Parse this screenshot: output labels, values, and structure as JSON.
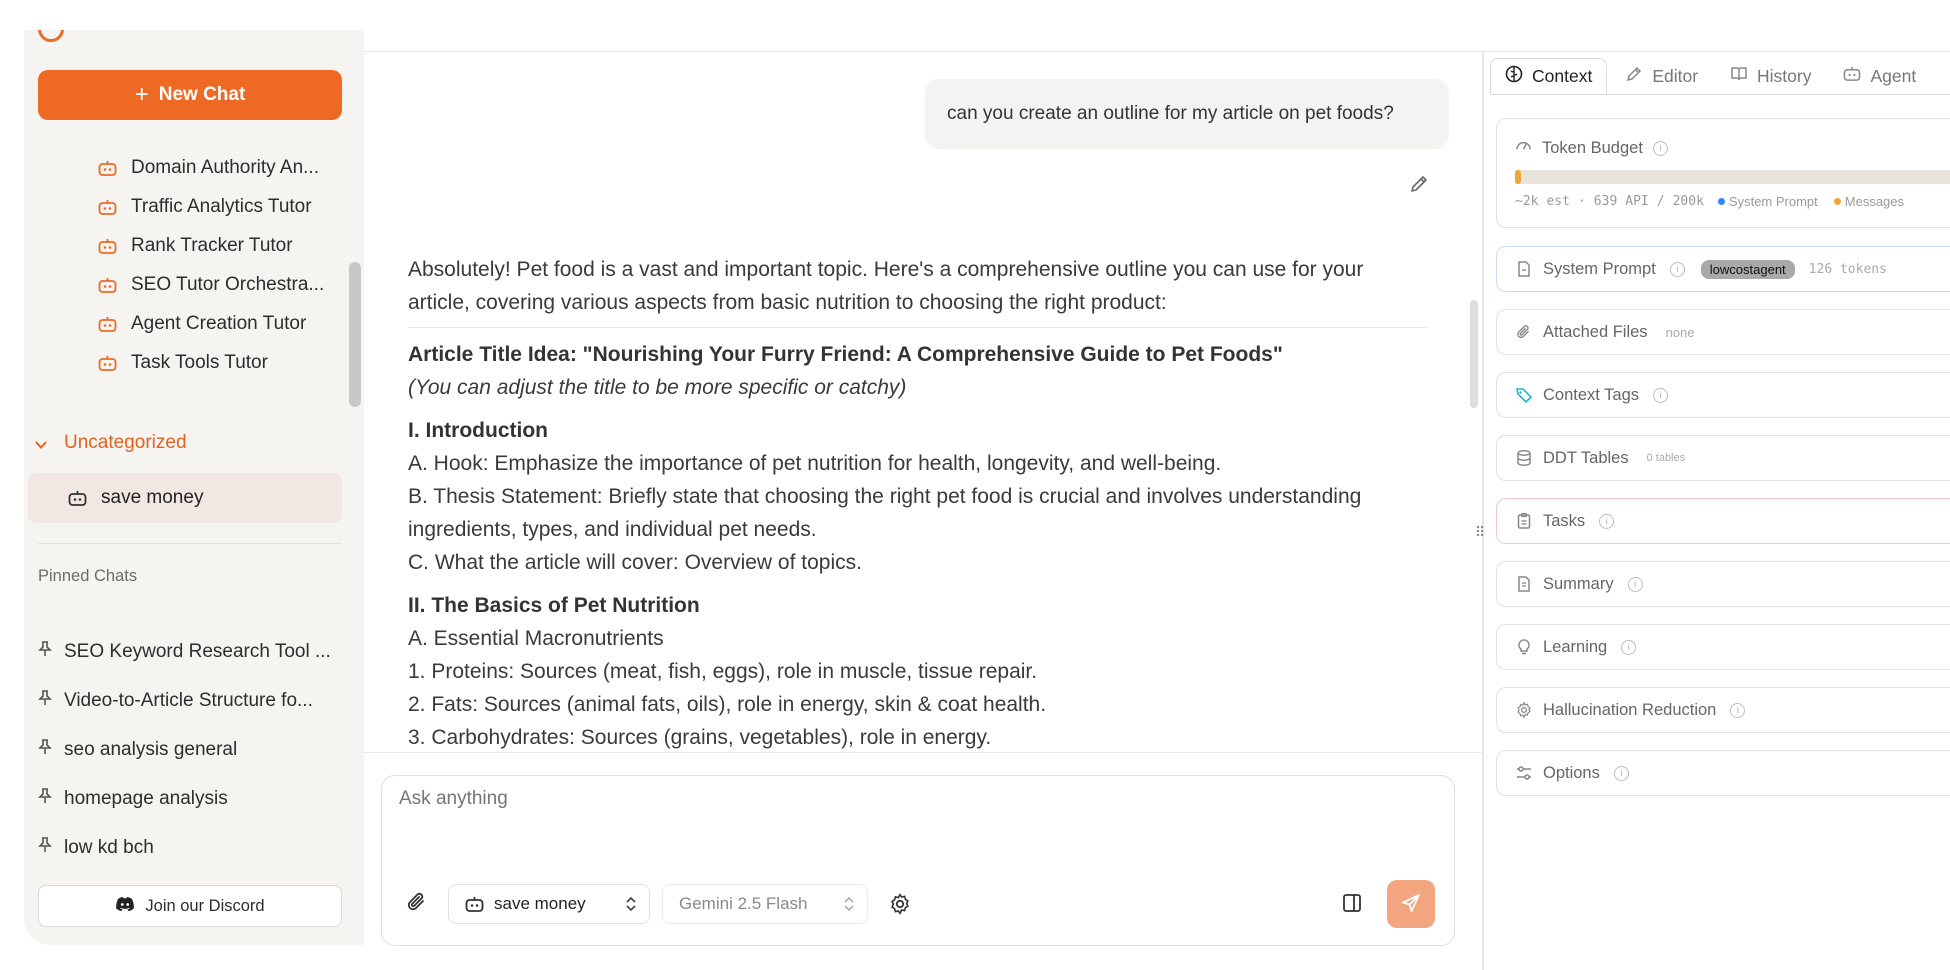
{
  "sidebar": {
    "new_chat_label": "New Chat",
    "agents": [
      "Domain Authority An...",
      "Traffic Analytics Tutor",
      "Rank Tracker Tutor",
      "SEO Tutor Orchestra...",
      "Agent Creation Tutor",
      "Task Tools Tutor"
    ],
    "group_label": "Uncategorized",
    "active_chat": "save money",
    "pinned_title": "Pinned Chats",
    "pinned": [
      "SEO Keyword Research Tool ...",
      "Video-to-Article Structure fo...",
      "seo analysis general",
      "homepage analysis",
      "low kd bch"
    ],
    "discord_label": "Join our Discord"
  },
  "chat": {
    "user_message": "can you create an outline for my article on pet foods?",
    "intro": "Absolutely! Pet food is a vast and important topic. Here's a comprehensive outline you can use for your article, covering various aspects from basic nutrition to choosing the right product:",
    "title_idea": "Article Title Idea: \"Nourishing Your Furry Friend: A Comprehensive Guide to Pet Foods\"",
    "title_note": "(You can adjust the title to be more specific or catchy)",
    "section1": "I. Introduction",
    "s1_a": "A. Hook: Emphasize the importance of pet nutrition for health, longevity, and well-being.",
    "s1_b": "B. Thesis Statement: Briefly state that choosing the right pet food is crucial and involves understanding ingredients, types, and individual pet needs.",
    "s1_c": "C. What the article will cover: Overview of topics.",
    "section2": "II. The Basics of Pet Nutrition",
    "s2_a": "A. Essential Macronutrients",
    "s2_1": "1. Proteins: Sources (meat, fish, eggs), role in muscle, tissue repair.",
    "s2_2": "2. Fats: Sources (animal fats, oils), role in energy, skin & coat health.",
    "s2_3": "3. Carbohydrates: Sources (grains, vegetables), role in energy."
  },
  "composer": {
    "placeholder": "Ask anything",
    "agent": "save money",
    "model": "Gemini 2.5 Flash"
  },
  "right_panel": {
    "tabs": [
      "Context",
      "Editor",
      "History",
      "Agent"
    ],
    "active_tab": "Context",
    "token_budget": {
      "label": "Token Budget",
      "est": "~2k",
      "est_label": "est",
      "api": "639",
      "api_label": "API",
      "limit": "200k",
      "legend_system": "System Prompt",
      "legend_messages": "Messages",
      "fill_fraction": 0.01,
      "color_system": "#3b82f6",
      "color_messages": "#f0a73a"
    },
    "system_prompt": {
      "label": "System Prompt",
      "badge": "lowcostagent",
      "tokens": "126 tokens"
    },
    "attached_files": {
      "label": "Attached Files",
      "value": "none"
    },
    "context_tags": "Context Tags",
    "ddt_tables": {
      "label": "DDT Tables",
      "value": "0 tables"
    },
    "tasks": "Tasks",
    "summary": "Summary",
    "learning": "Learning",
    "hallucination": "Hallucination Reduction",
    "options": "Options"
  },
  "colors": {
    "accent": "#ee6a24",
    "send": "#f2a57f",
    "active_bg": "#f1e8e3"
  }
}
